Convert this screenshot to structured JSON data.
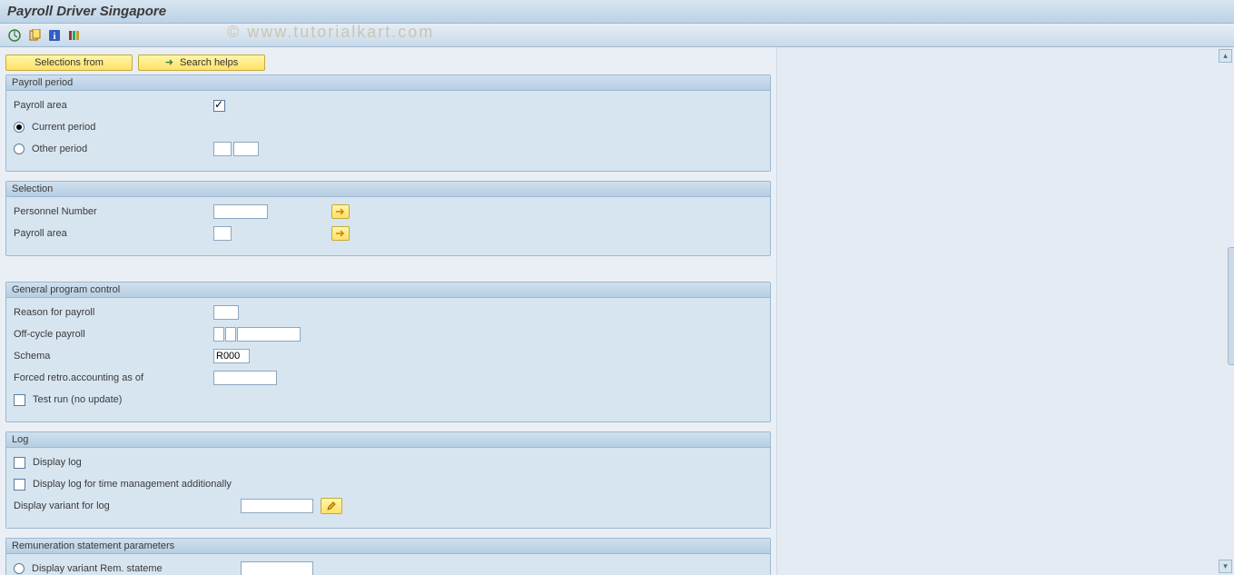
{
  "title": "Payroll Driver Singapore",
  "watermark": "© www.tutorialkart.com",
  "toolbar": {
    "icons": [
      "execute-icon",
      "variant-icon",
      "info-icon",
      "layout-icon"
    ]
  },
  "buttons": {
    "selections_from": "Selections from",
    "search_helps": "Search helps"
  },
  "groups": {
    "payroll_period": {
      "title": "Payroll period",
      "payroll_area_label": "Payroll area",
      "current_period_label": "Current period",
      "other_period_label": "Other period",
      "current_selected": true,
      "payroll_area_checked": true
    },
    "selection": {
      "title": "Selection",
      "personnel_number_label": "Personnel Number",
      "payroll_area_label": "Payroll area",
      "personnel_number_value": "",
      "payroll_area_value": ""
    },
    "general": {
      "title": "General program control",
      "reason_label": "Reason for payroll",
      "offcycle_label": "Off-cycle payroll",
      "schema_label": "Schema",
      "schema_value": "R000",
      "forced_retro_label": "Forced retro.accounting as of",
      "test_run_label": "Test run (no update)",
      "reason_value": "",
      "offcycle_value1": "",
      "offcycle_value2": "",
      "forced_retro_value": "",
      "test_run_checked": false
    },
    "log": {
      "title": "Log",
      "display_log_label": "Display log",
      "display_log_tm_label": "Display log for time management additionally",
      "display_variant_label": "Display variant for log",
      "display_log_checked": false,
      "display_log_tm_checked": false,
      "display_variant_value": ""
    },
    "remun": {
      "title": "Remuneration statement parameters",
      "display_variant_rem_label": "Display variant Rem. stateme",
      "display_variant_rem_selected": false,
      "display_variant_rem_value": ""
    }
  }
}
